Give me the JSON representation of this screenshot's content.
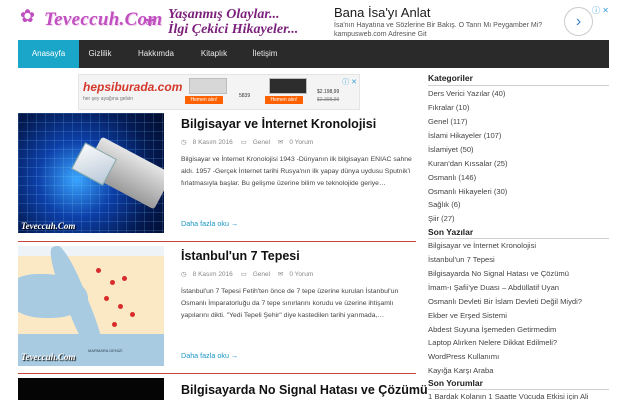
{
  "header": {
    "logo_text": "Teveccuh.Com",
    "tagline_line1": "Yaşanmış Olaylar...",
    "tagline_line2": "İlgi Çekici Hikayeler...",
    "ad": {
      "title": "Bana İsa'yı Anlat",
      "desc": "İsa'nın Hayatına ve Sözlerine Bir Bakış. O Tanrı Mı Peygamber Mi? kampusweb.com Adresine Git",
      "arrow_icon": "chevron-right-icon"
    }
  },
  "nav": [
    {
      "label": "Anasayfa",
      "active": true
    },
    {
      "label": "Gizlilik"
    },
    {
      "label": "Hakkımda"
    },
    {
      "label": "Kitaplık"
    },
    {
      "label": "İletişim"
    }
  ],
  "banner": {
    "logo": "hepsiburada.com",
    "sub": "her şey ayağına gelsin",
    "button": "Hemen alın!",
    "price1": "5839",
    "price2": "$2.198,99",
    "price2_old": "$2.398,99"
  },
  "posts": [
    {
      "title": "Bilgisayar ve İnternet Kronolojisi",
      "date": "8 Kasım 2016",
      "category": "Genel",
      "comments": "0 Yorum",
      "excerpt": "Bilgisayar ve İnternet Kronolojisi 1943 -Dünyanın ilk bilgisayarı ENIAC sahne aldı. 1957 -Gerçek İnternet tarihi Rusya'nın ilk yapay dünya uydusu Sputnik'i fırlatmasıyla başlar. Bu gelişme üzerine bilim ve teknolojide geriye…",
      "more": "Daha fazla oku →",
      "watermark": "Teveccuh.Com"
    },
    {
      "title": "İstanbul'un 7 Tepesi",
      "date": "8 Kasım 2016",
      "category": "Genel",
      "comments": "0 Yorum",
      "excerpt": "İstanbul'un 7 Tepesi Fetih'ten önce de 7 tepe üzerine kurulan İstanbul'un Osmanlı İmparatorluğu da 7 tepe sınırlarını korudu ve üzerine ihtişamlı yapılarını dikti. \"Yedi Tepeli Şehir\" diye kastedilen tarihi yarımada,…",
      "more": "Daha fazla oku →",
      "watermark": "Teveccuh.Com",
      "map_label": "MARMARA DENİZİ"
    },
    {
      "title": "Bilgisayarda No Signal Hatası ve Çözümü"
    }
  ],
  "sidebar": {
    "categories_title": "Kategoriler",
    "categories": [
      "Ders Verici Yazılar (40)",
      "Fıkralar (10)",
      "Genel (117)",
      "İslami Hikayeler (107)",
      "İslamiyet (50)",
      "Kuran'dan Kıssalar (25)",
      "Osmanlı (146)",
      "Osmanlı Hikayeleri (30)",
      "Sağlık (6)",
      "Şiir (27)"
    ],
    "recent_title": "Son Yazılar",
    "recent": [
      "Bilgisayar ve İnternet Kronolojisi",
      "İstanbul'un 7 Tepesi",
      "Bilgisayarda No Signal Hatası ve Çözümü",
      "İmam-ı Şafii'ye Duası – Abdüllatif Uyan",
      "Osmanlı Devleti Bir İslam Devleti Değil Miydi?",
      "Ekber ve Erşed Sistemi",
      "Abdest Suyuna İşemeden Getirmedim",
      "Laptop Alırken Nelere Dikkat Edilmeli?",
      "WordPress Kullanımı",
      "Kayığa Karşı Araba"
    ],
    "comments_title": "Son Yorumlar",
    "comments": [
      "1 Bardak Kolanın 1 Saatte Vücuda Etkisi için Ali"
    ]
  },
  "colors": {
    "accent": "#1aa6c8",
    "nav_bg": "#2a2a2a",
    "separator": "#c5443d",
    "link": "#1a95c4",
    "logo": "#c14fbf"
  }
}
